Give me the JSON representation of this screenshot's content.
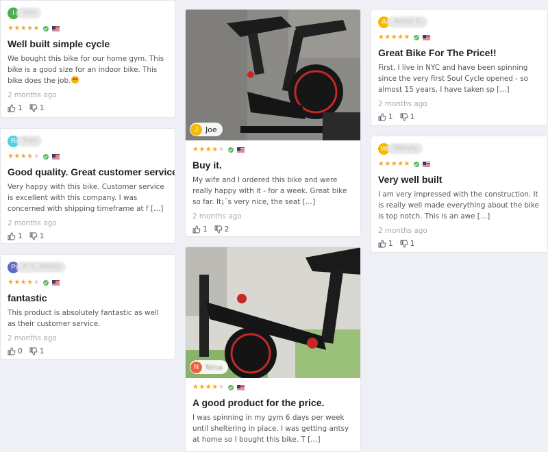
{
  "reviews": [
    {
      "initial": "I",
      "avatar_color": "#4caf50",
      "author": "Ilen",
      "stars": 5,
      "title": "Well built simple cycle",
      "body": "We bought this bike for our home gym. This bike is a good size for an indoor bike. This bike does the job.",
      "date": "2 months ago",
      "helpful": "1",
      "unhelpful": "1"
    },
    {
      "initial": "R",
      "avatar_color": "#4dd0e1",
      "author": "Ran",
      "stars": 4,
      "title": "Good quality. Great customer service",
      "body": "Very happy with this bike. Customer service is excellent with this company. I was concerned with shipping timeframe at f […]",
      "date": "2 months ago",
      "helpful": "1",
      "unhelpful": "1"
    },
    {
      "initial": "P",
      "avatar_color": "#5c6bc0",
      "author": "P. C. Kelley",
      "stars": 4,
      "title": "fantastic",
      "body": "This product is absolutely fantastic as well as their customer service.",
      "date": "2 months ago",
      "helpful": "0",
      "unhelpful": "1"
    },
    {
      "initial": "J",
      "avatar_color": "#f5b900",
      "author": "Joe",
      "stars": 4,
      "title": "Buy it.",
      "body": "My wife and I ordered this bike and were really happy with it - for a week. Great bike so far. It¡¯s very nice, the seat […]",
      "date": "2 months ago",
      "helpful": "1",
      "unhelpful": "2"
    },
    {
      "initial": "N",
      "avatar_color": "#f06040",
      "author": "Nina",
      "stars": 4,
      "title": "A good product for the price.",
      "body": "I was spinning in my gym 6 days per week until sheltering in place. I was getting antsy at home so I bought this bike. T […]",
      "date": "",
      "helpful": "",
      "unhelpful": ""
    },
    {
      "initial": "A",
      "avatar_color": "#f5b900",
      "author": "Annie S.",
      "stars": 5,
      "title": "Great Bike For The Price!!",
      "body": "First, I live in NYC and have been spinning since the very first Soul Cycle opened - so almost 15 years. I have taken sp […]",
      "date": "2 months ago",
      "helpful": "1",
      "unhelpful": "1"
    },
    {
      "initial": "W",
      "avatar_color": "#f5b900",
      "author": "Wendy",
      "stars": 5,
      "title": "Very well built",
      "body": "I am very impressed with the construction. It is really well made everything about the bike is top notch. This is an awe […]",
      "date": "2 months ago",
      "helpful": "1",
      "unhelpful": "1"
    }
  ],
  "icons": {
    "helpful": "thumbs-up-icon",
    "unhelpful": "thumbs-down-icon",
    "verified": "verified-check-icon",
    "country": "us-flag-icon",
    "emoji": "heart-eyes-emoji"
  }
}
